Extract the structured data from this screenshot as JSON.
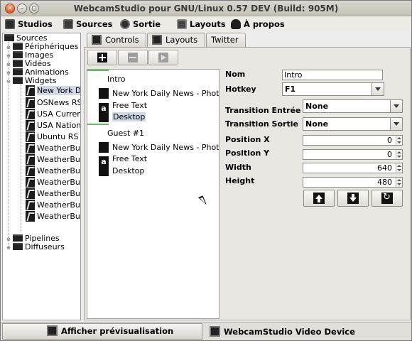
{
  "window": {
    "title": "WebcamStudio pour GNU/Linux 0.57 DEV (Build: 905M)",
    "close_glyph": "×",
    "minimize_glyph": "–",
    "maximize_glyph": "◻"
  },
  "menu": {
    "items": [
      {
        "label": "Studios",
        "icon": "studio-icon"
      },
      {
        "label": "Sources",
        "icon": "sources-icon"
      },
      {
        "label": "Sortie",
        "icon": "output-icon"
      },
      {
        "label": "Layouts",
        "icon": "layouts-icon"
      },
      {
        "label": "À propos",
        "icon": "about-icon"
      }
    ]
  },
  "tree": {
    "root": "Sources",
    "categories": [
      "Périphériques",
      "Images",
      "Vidéos",
      "Animations",
      "Widgets"
    ],
    "widgets": [
      "New York D",
      "OSNews RS",
      "USA Curren",
      "USA Nation",
      "Ubuntu RS",
      "WeatherBu",
      "WeatherBu",
      "WeatherBu",
      "WeatherBu",
      "WeatherBu",
      "WeatherBu",
      "WeatherBu"
    ],
    "after": [
      "Pipelines",
      "Diffuseurs"
    ],
    "expand_glyph": "⊖",
    "collapse_glyph": "⊕"
  },
  "tabs": [
    {
      "label": "Controls",
      "active": false
    },
    {
      "label": "Layouts",
      "active": true
    },
    {
      "label": "Twitter",
      "active": false
    }
  ],
  "layouts": {
    "groups": [
      {
        "name": "Intro",
        "items": [
          {
            "label": "New York Daily News - Photo",
            "icon": "widget-icon",
            "selected": false
          },
          {
            "label": "Free Text",
            "icon": "text-icon",
            "selected": false
          },
          {
            "label": "Desktop",
            "icon": "desktop-icon",
            "selected": true
          }
        ]
      },
      {
        "name": "Guest #1",
        "items": [
          {
            "label": "New York Daily News - Photo",
            "icon": "widget-icon",
            "selected": false
          },
          {
            "label": "Free Text",
            "icon": "text-icon",
            "selected": false
          },
          {
            "label": "Desktop",
            "icon": "desktop-icon",
            "selected": false
          }
        ]
      }
    ],
    "text_icon_glyph": "a"
  },
  "properties": {
    "nom_label": "Nom",
    "nom_value": "Intro",
    "hotkey_label": "Hotkey",
    "hotkey_value": "F1",
    "trans_in_label": "Transition Entrée",
    "trans_in_value": "None",
    "trans_out_label": "Transition Sortie",
    "trans_out_value": "None",
    "posx_label": "Position X",
    "posx_value": "0",
    "posy_label": "Position Y",
    "posy_value": "0",
    "width_label": "Width",
    "width_value": "640",
    "height_label": "Height",
    "height_value": "480"
  },
  "bottom": {
    "preview_label": "Afficher prévisualisation",
    "device_label": "WebcamStudio Video Device"
  }
}
